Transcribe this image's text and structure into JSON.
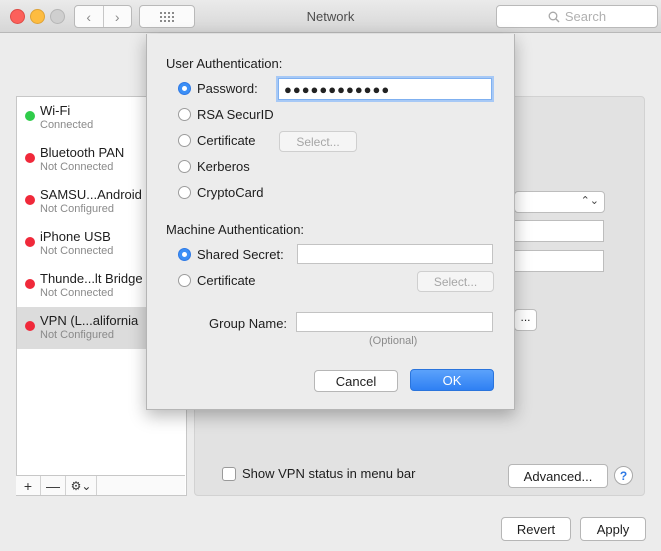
{
  "window": {
    "title": "Network",
    "search_placeholder": "Search",
    "back_icon": "‹",
    "forward_icon": "›"
  },
  "services": [
    {
      "name": "Wi-Fi",
      "status": "Connected",
      "color": "#2fcc4a"
    },
    {
      "name": "Bluetooth PAN",
      "status": "Not Connected",
      "color": "#f0293a"
    },
    {
      "name": "SAMSU...Android",
      "status": "Not Configured",
      "color": "#f0293a"
    },
    {
      "name": "iPhone USB",
      "status": "Not Connected",
      "color": "#f0293a"
    },
    {
      "name": "Thunde...lt Bridge",
      "status": "Not Connected",
      "color": "#f0293a"
    },
    {
      "name": "VPN (L...alifornia",
      "status": "Not Configured",
      "color": "#f0293a"
    }
  ],
  "list_tools": {
    "add": "+",
    "remove": "—",
    "action": "⚙⌄"
  },
  "detail": {
    "show_vpn_status_label": "Show VPN status in menu bar",
    "show_vpn_status_checked": false,
    "advanced_label": "Advanced...",
    "help_label": "?",
    "partial_button": "..."
  },
  "footer": {
    "revert_label": "Revert",
    "apply_label": "Apply"
  },
  "sheet": {
    "user_auth_title": "User Authentication:",
    "user_auth_options": [
      {
        "label": "Password:",
        "selected": true
      },
      {
        "label": "RSA SecurID",
        "selected": false
      },
      {
        "label": "Certificate",
        "selected": false
      },
      {
        "label": "Kerberos",
        "selected": false
      },
      {
        "label": "CryptoCard",
        "selected": false
      }
    ],
    "password_value": "●●●●●●●●●●●●",
    "certificate_select_label": "Select...",
    "machine_auth_title": "Machine Authentication:",
    "machine_auth_options": [
      {
        "label": "Shared Secret:",
        "selected": true
      },
      {
        "label": "Certificate",
        "selected": false
      }
    ],
    "shared_secret_value": "",
    "machine_select_label": "Select...",
    "group_name_label": "Group Name:",
    "group_name_value": "",
    "optional_hint": "(Optional)",
    "cancel_label": "Cancel",
    "ok_label": "OK"
  },
  "colors": {
    "accent": "#3b8ff6",
    "connected": "#2fcc4a",
    "disconnected": "#f0293a"
  }
}
